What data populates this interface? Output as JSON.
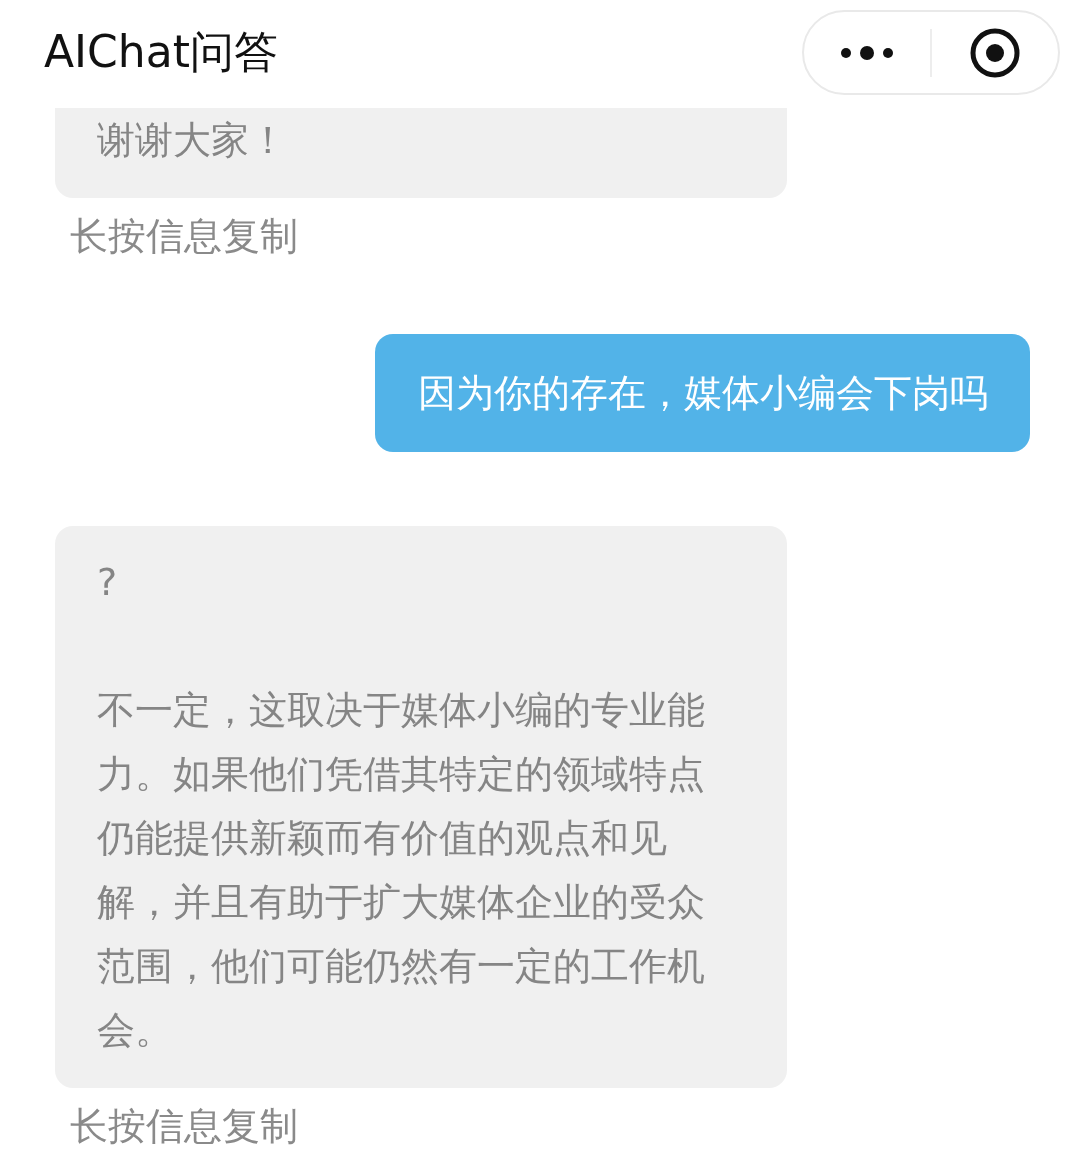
{
  "header": {
    "title": "AIChat问答"
  },
  "messages": [
    {
      "kind": "bot",
      "paragraphs": [
        "谢谢大家！"
      ],
      "hint": "长按信息复制"
    },
    {
      "kind": "user",
      "paragraphs": [
        "因为你的存在，媒体小编会下岗吗"
      ]
    },
    {
      "kind": "bot",
      "paragraphs": [
        "?",
        "不一定，这取决于媒体小编的专业能力。如果他们凭借其特定的领域特点仍能提供新颖而有价值的观点和见解，并且有助于扩大媒体企业的受众范围，他们可能仍然有一定的工作机会。"
      ],
      "hint": "长按信息复制"
    }
  ]
}
